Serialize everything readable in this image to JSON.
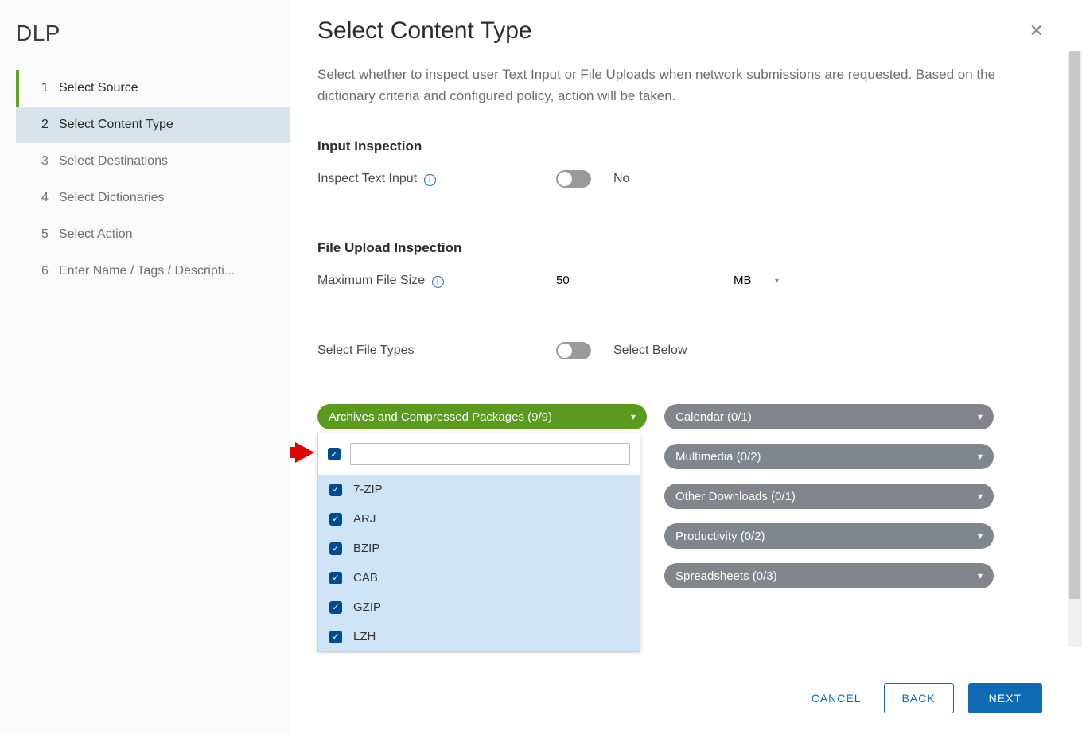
{
  "sidebar": {
    "title": "DLP",
    "steps": [
      {
        "num": "1",
        "label": "Select Source"
      },
      {
        "num": "2",
        "label": "Select Content Type"
      },
      {
        "num": "3",
        "label": "Select Destinations"
      },
      {
        "num": "4",
        "label": "Select Dictionaries"
      },
      {
        "num": "5",
        "label": "Select Action"
      },
      {
        "num": "6",
        "label": "Enter Name / Tags / Descripti..."
      }
    ]
  },
  "header": {
    "title": "Select Content Type",
    "description": "Select whether to inspect user Text Input or File Uploads when network submissions are requested. Based on the dictionary criteria and configured policy, action will be taken."
  },
  "input_inspection": {
    "heading": "Input Inspection",
    "toggle_label": "Inspect Text Input",
    "toggle_value_text": "No"
  },
  "file_upload": {
    "heading": "File Upload Inspection",
    "max_size_label": "Maximum File Size",
    "max_size_value": "50",
    "unit": "MB",
    "select_types_label": "Select File Types",
    "select_types_value_text": "Select Below"
  },
  "file_type_groups": {
    "open": {
      "label": "Archives and Compressed Packages (9/9)"
    },
    "right": [
      "Calendar (0/1)",
      "Multimedia (0/2)",
      "Other Downloads (0/1)",
      "Productivity (0/2)",
      "Spreadsheets (0/3)"
    ]
  },
  "dropdown": {
    "search_placeholder": "",
    "items": [
      "7-ZIP",
      "ARJ",
      "BZIP",
      "CAB",
      "GZIP",
      "LZH"
    ]
  },
  "footer": {
    "cancel": "CANCEL",
    "back": "BACK",
    "next": "NEXT"
  }
}
